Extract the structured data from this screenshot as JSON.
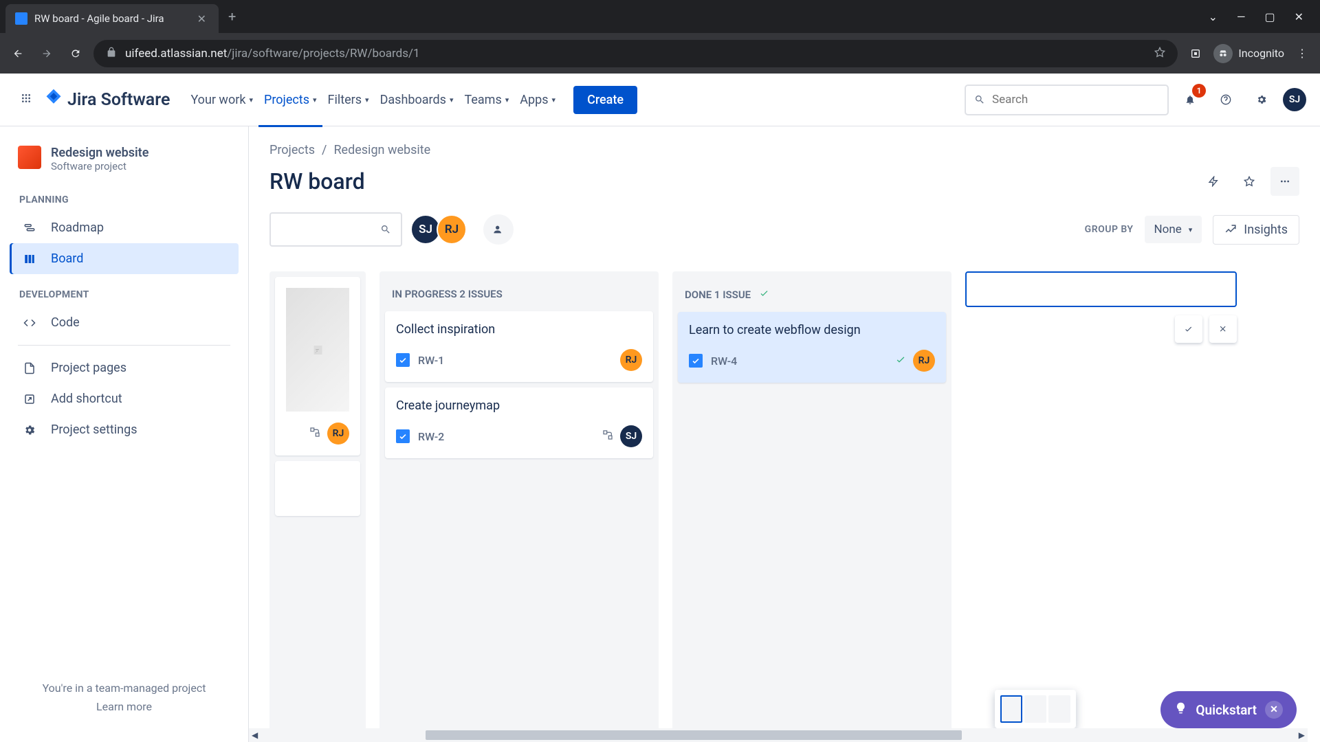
{
  "browser": {
    "tab_title": "RW board - Agile board - Jira",
    "url_domain": "uifeed.atlassian.net",
    "url_path": "/jira/software/projects/RW/boards/1",
    "incognito_label": "Incognito"
  },
  "header": {
    "logo": "Jira Software",
    "nav": [
      "Your work",
      "Projects",
      "Filters",
      "Dashboards",
      "Teams",
      "Apps"
    ],
    "active_nav_index": 1,
    "create_label": "Create",
    "search_placeholder": "Search",
    "notification_count": "1",
    "user_initials": "SJ"
  },
  "sidebar": {
    "project_name": "Redesign website",
    "project_type": "Software project",
    "sections": {
      "planning": {
        "label": "PLANNING",
        "items": [
          "Roadmap",
          "Board"
        ],
        "active_index": 1
      },
      "development": {
        "label": "DEVELOPMENT",
        "items": [
          "Code"
        ]
      }
    },
    "extra": [
      "Project pages",
      "Add shortcut",
      "Project settings"
    ],
    "footer_text": "You're in a team-managed project",
    "learn_more": "Learn more"
  },
  "breadcrumb": {
    "root": "Projects",
    "separator": "/",
    "current": "Redesign website"
  },
  "board": {
    "title": "RW board",
    "groupby_label": "GROUP BY",
    "groupby_value": "None",
    "insights_label": "Insights",
    "avatars": [
      "SJ",
      "RJ"
    ]
  },
  "columns": [
    {
      "partial": true,
      "cards": [
        {
          "has_image": true,
          "assignee": "RJ",
          "assignee_color": "#ff991f",
          "subtask": true
        },
        {
          "blank": true
        }
      ]
    },
    {
      "header": "IN PROGRESS 2 ISSUES",
      "cards": [
        {
          "title": "Collect inspiration",
          "key": "RW-1",
          "assignee": "RJ",
          "assignee_color": "#ff991f"
        },
        {
          "title": "Create journeymap",
          "key": "RW-2",
          "assignee": "SJ",
          "assignee_color": "#172b4d",
          "assignee_text": "#fff",
          "subtask": true
        }
      ]
    },
    {
      "header": "DONE 1 ISSUE",
      "done_col": true,
      "cards": [
        {
          "title": "Learn to create webflow design",
          "key": "RW-4",
          "assignee": "RJ",
          "assignee_color": "#ff991f",
          "done": true
        }
      ]
    }
  ],
  "quickstart_label": "Quickstart"
}
